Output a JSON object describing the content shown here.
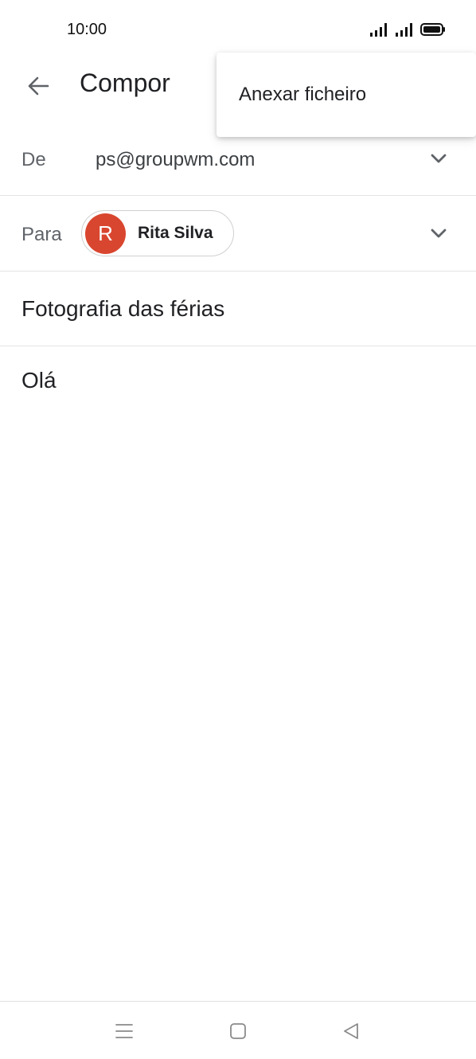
{
  "status_bar": {
    "time": "10:00",
    "icons": [
      "signal-icon",
      "signal-icon",
      "battery-icon"
    ]
  },
  "app_bar": {
    "back_icon": "arrow-left-icon",
    "title": "Compor"
  },
  "popup_menu": {
    "items": [
      {
        "label": "Anexar ficheiro"
      }
    ]
  },
  "compose": {
    "from": {
      "label": "De",
      "value": "ps@groupwm.com",
      "icon": "chevron-down-icon"
    },
    "to": {
      "label": "Para",
      "recipients": [
        {
          "initial": "R",
          "name": "Rita Silva",
          "avatar_color": "#d9462f"
        }
      ],
      "icon": "chevron-down-icon"
    },
    "subject": "Fotografia das férias",
    "body": "Olá"
  },
  "nav_bar": {
    "icons": [
      "menu-icon",
      "home-icon",
      "back-triangle-icon"
    ]
  }
}
